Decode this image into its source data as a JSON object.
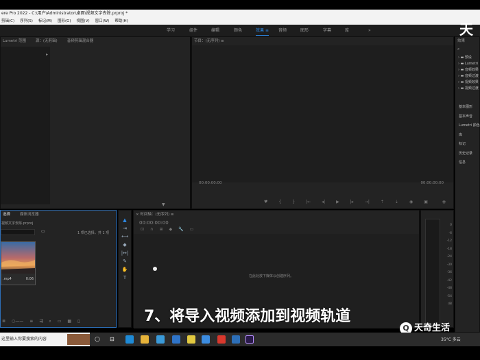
{
  "title_bar": {
    "text": "ere Pro 2022 - C:\\用户\\Administrator\\桌面\\视频文字去除.prproj *"
  },
  "menu": [
    "剪辑(C)",
    "序列(S)",
    "标记(M)",
    "图形(G)",
    "视图(V)",
    "窗口(W)",
    "帮助(H)"
  ],
  "workspace_tabs": [
    {
      "label": "学习"
    },
    {
      "label": "组件"
    },
    {
      "label": "编辑"
    },
    {
      "label": "颜色"
    },
    {
      "label": "效果",
      "active": true
    },
    {
      "label": "音频"
    },
    {
      "label": "图形"
    },
    {
      "label": "字幕"
    },
    {
      "label": "库"
    },
    {
      "label": "»"
    }
  ],
  "source_panel": {
    "tabs": [
      "Lumetri 范围",
      "源：(无剪辑)",
      "音频剪辑混合器"
    ]
  },
  "program_panel": {
    "title": "节目：(无序列) ≡",
    "timecode_left": "00:00:00:00",
    "timecode_right": "00:00:00:00"
  },
  "effects_panel": {
    "title": "效果",
    "tree": [
      "预设",
      "Lumetri",
      "音频效果",
      "音频过渡",
      "视频效果",
      "视频过渡"
    ],
    "sections": [
      "基本图形",
      "基本声音",
      "Lumetri 颜色",
      "库",
      "标记",
      "历史记录",
      "信息"
    ]
  },
  "project_panel": {
    "tabs": [
      "选择",
      "媒体浏览器"
    ],
    "project_file": "视频文字去除.prproj",
    "selection_info": "1 项已选择，共 1 项",
    "clip": {
      "name": ".mp4",
      "duration": "0:06"
    }
  },
  "timeline_panel": {
    "title": "时间轴：(无序列) ≡",
    "timecode": "00:00:00:00",
    "placeholder": "在此处放下媒体以创建序列。"
  },
  "vu_meter": {
    "labels": [
      "0",
      "-6",
      "-12",
      "-18",
      "-24",
      "-30",
      "-36",
      "-42",
      "-48",
      "-54"
    ],
    "unit": "dB"
  },
  "caption": "7、将导入视频添加到视频轨道",
  "watermark": "天奇生活",
  "logo_char": "天",
  "taskbar": {
    "search_placeholder": "这里输入你要搜索的内容",
    "weather": "35°C 多云",
    "time": "2022"
  },
  "colors": {
    "accent": "#2d8ceb",
    "panel_bg": "#232323",
    "window_bg": "#1d1d1d"
  }
}
